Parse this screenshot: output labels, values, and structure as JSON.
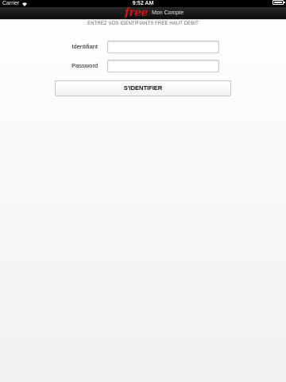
{
  "status_bar": {
    "carrier": "Carrier",
    "time": "9:52 AM",
    "battery_level": 1.0,
    "icons": [
      "wifi-icon",
      "battery-icon"
    ]
  },
  "nav": {
    "brand": "free",
    "title": "Mon Compte",
    "brand_color": "#d2151b"
  },
  "form": {
    "instructions": "ENTREZ VOS IDENTIFIANTS FREE HAUT DEBIT",
    "username_label": "Identifiant",
    "username_value": "",
    "password_label": "Password",
    "password_value": "",
    "submit_label": "S'IDENTIFIER"
  }
}
